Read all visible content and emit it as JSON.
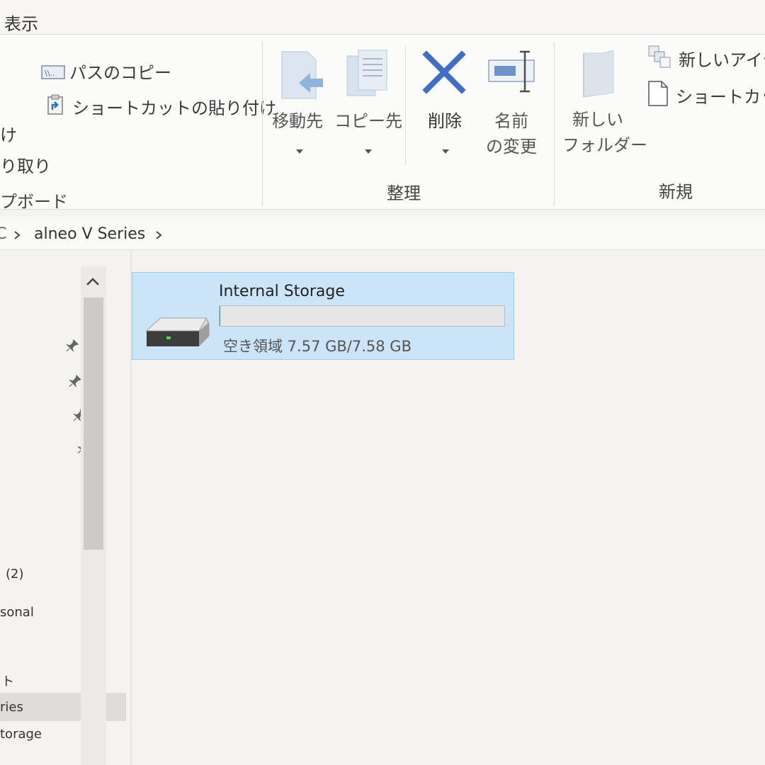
{
  "menu": {
    "view": "表示"
  },
  "clipboard": {
    "copy_path": "パスのコピー",
    "paste_shortcut": "ショートカットの貼り付け",
    "paste_fragment": "け",
    "cut_fragment": "り取り",
    "group_fragment": "プボード"
  },
  "organize": {
    "move_to": "移動先",
    "copy_to": "コピー先",
    "delete": "削除",
    "rename_line1": "名前",
    "rename_line2": "の変更",
    "group": "整理"
  },
  "new": {
    "new_folder_line1": "新しい",
    "new_folder_line2": "フォルダー",
    "new_item": "新しいアイテ",
    "easy_access": "ショートカット",
    "group": "新規"
  },
  "address": {
    "prefix": "C",
    "crumb": "alneo V Series"
  },
  "nav": {
    "item_count": "(2)",
    "personal": "sonal",
    "fragment": "ト",
    "series": "ries",
    "storage": "torage"
  },
  "drive": {
    "name": "Internal Storage",
    "free_text": "空き領域 7.57 GB/7.58 GB",
    "used_fraction": 0.0013
  },
  "icons": [
    "copy-path-icon",
    "paste-shortcut-icon",
    "move-to-icon",
    "copy-to-icon",
    "delete-icon",
    "rename-icon",
    "new-folder-icon",
    "new-item-icon",
    "easy-access-icon",
    "pin-icon",
    "chevron-up-icon",
    "hard-drive-icon"
  ]
}
